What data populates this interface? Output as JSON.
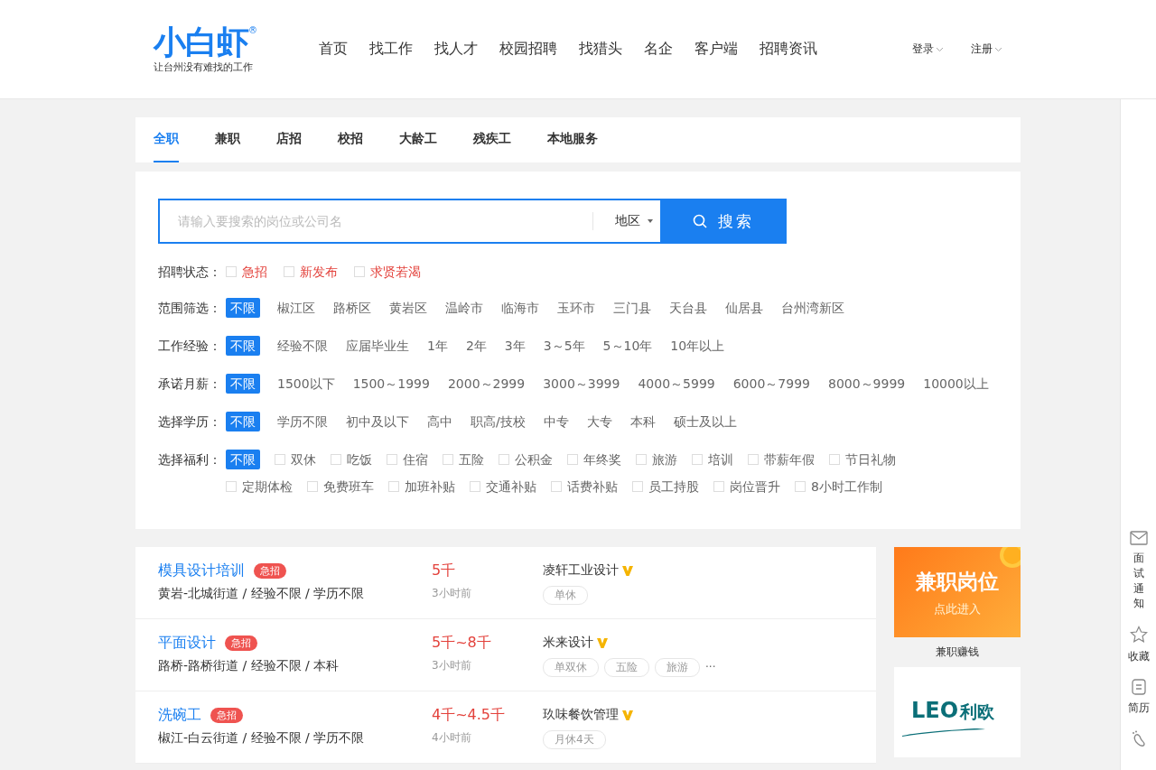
{
  "header": {
    "logo": "小白虾",
    "logo_mark": "®",
    "slogan": "让台州没有难找的工作",
    "nav": [
      "首页",
      "找工作",
      "找人才",
      "校园招聘",
      "找猎头",
      "名企",
      "客户端",
      "招聘资讯"
    ],
    "account": [
      "登录",
      "注册"
    ]
  },
  "tabs": [
    {
      "label": "全职",
      "selected": true
    },
    {
      "label": "兼职",
      "selected": false
    },
    {
      "label": "店招",
      "selected": false
    },
    {
      "label": "校招",
      "selected": false
    },
    {
      "label": "大龄工",
      "selected": false
    },
    {
      "label": "残疾工",
      "selected": false
    },
    {
      "label": "本地服务",
      "selected": false
    }
  ],
  "search": {
    "placeholder": "请输入要搜索的岗位或公司名",
    "region": "地区",
    "button": "搜索"
  },
  "filters": [
    {
      "label": "招聘状态：",
      "kind": "status",
      "options": [
        {
          "text": "急招",
          "checked": false
        },
        {
          "text": "新发布",
          "checked": false
        },
        {
          "text": "求贤若渴",
          "checked": false
        }
      ]
    },
    {
      "label": "范围筛选：",
      "kind": "choice",
      "options": [
        {
          "text": "不限",
          "selected": true
        },
        {
          "text": "椒江区",
          "selected": false
        },
        {
          "text": "路桥区",
          "selected": false
        },
        {
          "text": "黄岩区",
          "selected": false
        },
        {
          "text": "温岭市",
          "selected": false
        },
        {
          "text": "临海市",
          "selected": false
        },
        {
          "text": "玉环市",
          "selected": false
        },
        {
          "text": "三门县",
          "selected": false
        },
        {
          "text": "天台县",
          "selected": false
        },
        {
          "text": "仙居县",
          "selected": false
        },
        {
          "text": "台州湾新区",
          "selected": false
        }
      ]
    },
    {
      "label": "工作经验：",
      "kind": "choice",
      "options": [
        {
          "text": "不限",
          "selected": true
        },
        {
          "text": "经验不限",
          "selected": false
        },
        {
          "text": "应届毕业生",
          "selected": false
        },
        {
          "text": "1年",
          "selected": false
        },
        {
          "text": "2年",
          "selected": false
        },
        {
          "text": "3年",
          "selected": false
        },
        {
          "text": "3～5年",
          "selected": false
        },
        {
          "text": "5～10年",
          "selected": false
        },
        {
          "text": "10年以上",
          "selected": false
        }
      ]
    },
    {
      "label": "承诺月薪：",
      "kind": "choice",
      "options": [
        {
          "text": "不限",
          "selected": true
        },
        {
          "text": "1500以下",
          "selected": false
        },
        {
          "text": "1500～1999",
          "selected": false
        },
        {
          "text": "2000～2999",
          "selected": false
        },
        {
          "text": "3000～3999",
          "selected": false
        },
        {
          "text": "4000～5999",
          "selected": false
        },
        {
          "text": "6000～7999",
          "selected": false
        },
        {
          "text": "8000～9999",
          "selected": false
        },
        {
          "text": "10000以上",
          "selected": false
        }
      ]
    },
    {
      "label": "选择学历：",
      "kind": "choice",
      "options": [
        {
          "text": "不限",
          "selected": true
        },
        {
          "text": "学历不限",
          "selected": false
        },
        {
          "text": "初中及以下",
          "selected": false
        },
        {
          "text": "高中",
          "selected": false
        },
        {
          "text": "职高/技校",
          "selected": false
        },
        {
          "text": "中专",
          "selected": false
        },
        {
          "text": "大专",
          "selected": false
        },
        {
          "text": "本科",
          "selected": false
        },
        {
          "text": "硕士及以上",
          "selected": false
        }
      ]
    },
    {
      "label": "选择福利：",
      "kind": "benefit",
      "all": {
        "text": "不限",
        "selected": true
      },
      "options": [
        {
          "text": "双休",
          "checked": false
        },
        {
          "text": "吃饭",
          "checked": false
        },
        {
          "text": "住宿",
          "checked": false
        },
        {
          "text": "五险",
          "checked": false
        },
        {
          "text": "公积金",
          "checked": false
        },
        {
          "text": "年终奖",
          "checked": false
        },
        {
          "text": "旅游",
          "checked": false
        },
        {
          "text": "培训",
          "checked": false
        },
        {
          "text": "带薪年假",
          "checked": false
        },
        {
          "text": "节日礼物",
          "checked": false
        },
        {
          "text": "定期体检",
          "checked": false
        },
        {
          "text": "免费班车",
          "checked": false
        },
        {
          "text": "加班补贴",
          "checked": false
        },
        {
          "text": "交通补贴",
          "checked": false
        },
        {
          "text": "话费补贴",
          "checked": false
        },
        {
          "text": "员工持股",
          "checked": false
        },
        {
          "text": "岗位晋升",
          "checked": false
        },
        {
          "text": "8小时工作制",
          "checked": false
        }
      ]
    }
  ],
  "jobs": [
    {
      "title": "模具设计培训",
      "urgent": true,
      "badge": "急招",
      "meta": "黄岩-北城街道 / 经验不限 / 学历不限",
      "salary": "5千",
      "time": "3小时前",
      "company": "凌轩工业设计",
      "verified": true,
      "tags": [
        "单休"
      ]
    },
    {
      "title": "平面设计",
      "urgent": true,
      "badge": "急招",
      "meta": "路桥-路桥街道 / 经验不限 / 本科",
      "salary": "5千~8千",
      "time": "3小时前",
      "company": "米来设计",
      "verified": true,
      "tags": [
        "单双休",
        "五险",
        "旅游"
      ],
      "more": "···"
    },
    {
      "title": "洗碗工",
      "urgent": true,
      "badge": "急招",
      "meta": "椒江-白云街道 / 经验不限 / 学历不限",
      "salary": "4千~4.5千",
      "time": "4小时前",
      "company": "玖味餐饮管理",
      "verified": true,
      "tags": [
        "月休4天"
      ]
    }
  ],
  "ads": [
    {
      "kind": "banner",
      "headline": "兼职岗位",
      "sub": "点此进入",
      "caption": "兼职赚钱"
    },
    {
      "kind": "logo",
      "brand": "LEO",
      "brand_cn": "利欧"
    }
  ],
  "side": [
    {
      "kind": "mail",
      "label": "面试通知",
      "vertical": true
    },
    {
      "kind": "star",
      "label": "收藏",
      "vertical": false
    },
    {
      "kind": "resume",
      "label": "简历",
      "vertical": false
    },
    {
      "kind": "foot"
    }
  ]
}
